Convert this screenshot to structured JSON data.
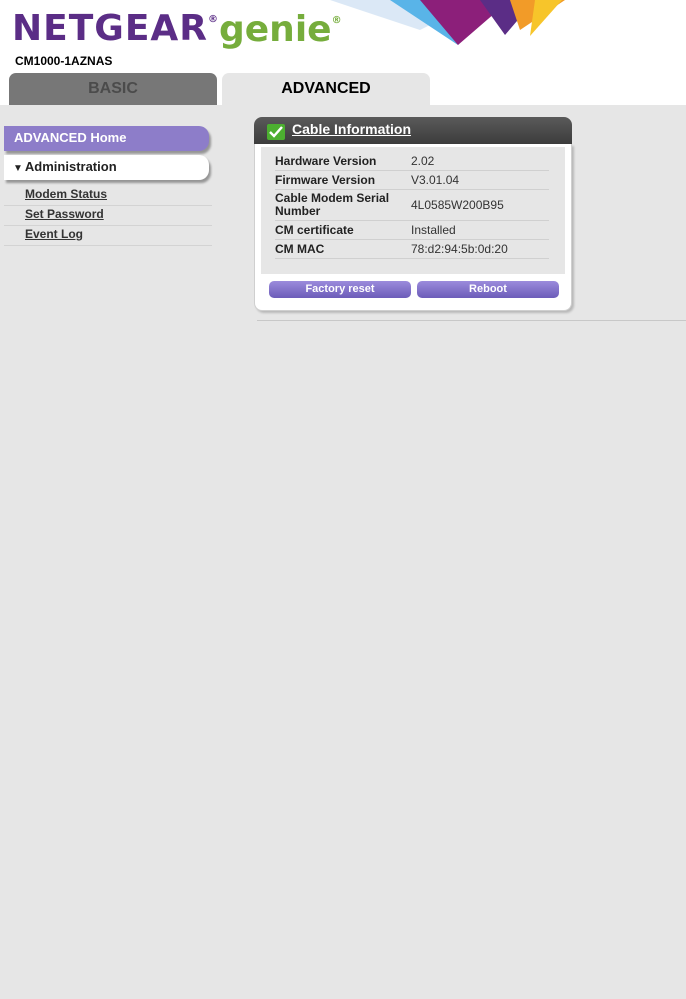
{
  "header": {
    "brand": "NETGEAR",
    "brand_mark": "®",
    "product": "genie",
    "product_mark": "®",
    "model": "CM1000-1AZNAS"
  },
  "tabs": {
    "basic": "BASIC",
    "advanced": "ADVANCED"
  },
  "sidebar": {
    "home": "ADVANCED Home",
    "section": "Administration",
    "section_icon": "triangle-down-icon",
    "links": [
      "Modem Status",
      "Set Password",
      "Event Log"
    ]
  },
  "panel": {
    "title": "Cable Information",
    "title_icon": "check-icon",
    "rows": [
      {
        "label": "Hardware Version",
        "value": "2.02"
      },
      {
        "label": "Firmware Version",
        "value": "V3.01.04"
      },
      {
        "label": "Cable Modem Serial Number",
        "value": "4L0585W200B95"
      },
      {
        "label": "CM certificate",
        "value": "Installed"
      },
      {
        "label": "CM MAC",
        "value": "78:d2:94:5b:0d:20"
      }
    ],
    "buttons": {
      "factory_reset": "Factory reset",
      "reboot": "Reboot"
    }
  },
  "colors": {
    "brand_purple": "#5b2d86",
    "brand_green": "#76ad3c",
    "accent_lavender": "#8d7dc9",
    "tab_inactive": "#777777",
    "background": "#e6e6e6"
  }
}
